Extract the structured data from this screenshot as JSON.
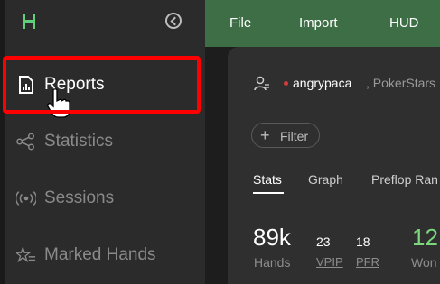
{
  "sidebar": {
    "items": [
      {
        "label": "Reports",
        "icon": "report-icon"
      },
      {
        "label": "Statistics",
        "icon": "share-nodes-icon"
      },
      {
        "label": "Sessions",
        "icon": "broadcast-icon"
      },
      {
        "label": "Marked Hands",
        "icon": "star-list-icon"
      }
    ]
  },
  "menu": {
    "file": "File",
    "import": "Import",
    "hud": "HUD"
  },
  "player": {
    "name": "angrypaca",
    "site": ", PokerStars"
  },
  "filter": {
    "plus": "+",
    "label": "Filter"
  },
  "tabs": {
    "stats": "Stats",
    "graph": "Graph",
    "preflop": "Preflop Ran"
  },
  "stats": {
    "hands_value": "89k",
    "hands_label": "Hands",
    "vpip_value": "23",
    "vpip_label": "VPIP",
    "pfr_value": "18",
    "pfr_label": "PFR",
    "won_value": "12",
    "won_label": "Won"
  },
  "colors": {
    "brand_green": "#3e6e45",
    "highlight": "#ff0000",
    "positive": "#7bd67e"
  }
}
